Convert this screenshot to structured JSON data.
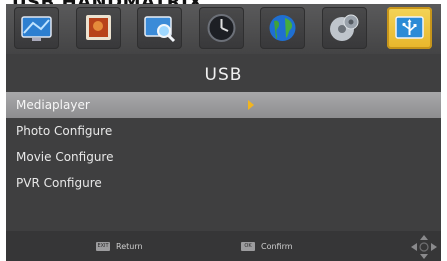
{
  "cut_title": "USB HANDMATRIX",
  "tabs": [
    {
      "name": "tv-icon"
    },
    {
      "name": "picture-icon"
    },
    {
      "name": "search-icon"
    },
    {
      "name": "clock-icon"
    },
    {
      "name": "globe-icon"
    },
    {
      "name": "disc-icon"
    },
    {
      "name": "usb-icon",
      "active": true
    }
  ],
  "title": "USB",
  "menu": {
    "items": [
      {
        "label": "Mediaplayer",
        "selected": true
      },
      {
        "label": "Photo Configure"
      },
      {
        "label": "Movie Configure"
      },
      {
        "label": "PVR Configure"
      }
    ]
  },
  "footer": {
    "return_key": "EXIT",
    "return_label": "Return",
    "confirm_key": "OK",
    "confirm_label": "Confirm"
  },
  "colors": {
    "accent": "#f2b51f",
    "selected_bg": "#9a9a9c",
    "screen_bg": "#3f3f40"
  }
}
